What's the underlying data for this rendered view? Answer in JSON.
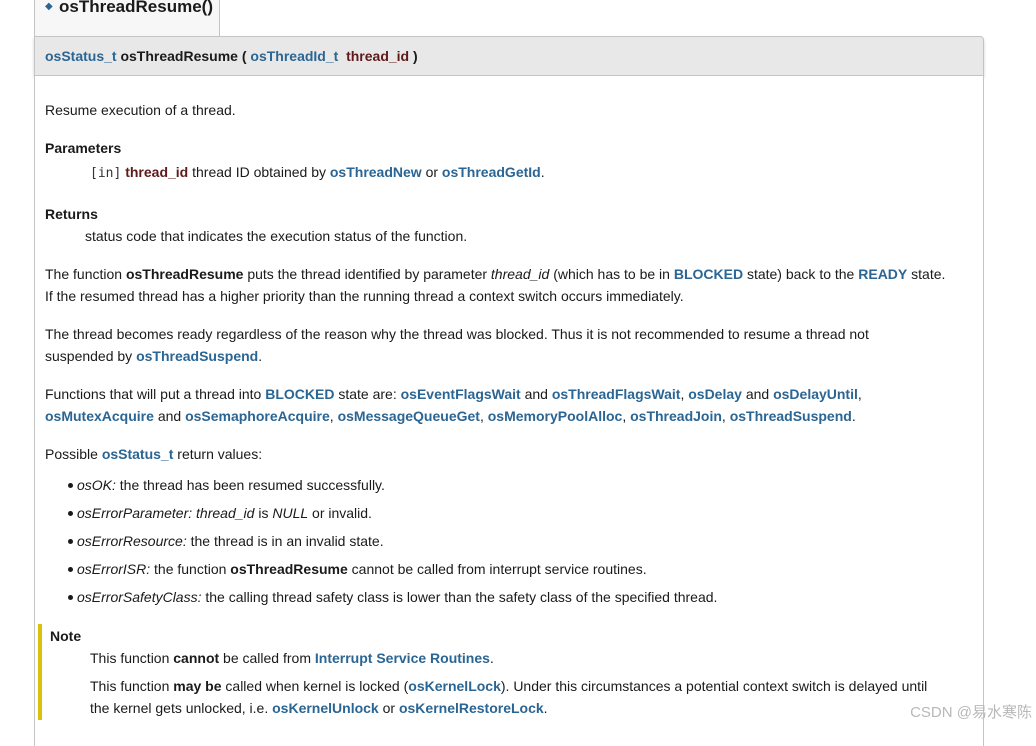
{
  "header": {
    "tab_title": "osThreadResume()",
    "sig_ret_type": "osStatus_t",
    "sig_func": "osThreadResume",
    "sig_open": "(",
    "sig_param_type": "osThreadId_t",
    "sig_param_name": "thread_id",
    "sig_close": ")"
  },
  "doc": {
    "brief": "Resume execution of a thread.",
    "params_heading": "Parameters",
    "param_dir": "[in]",
    "param_name": "thread_id",
    "param_desc_1": "thread ID obtained by",
    "param_link_1": "osThreadNew",
    "param_or": "or",
    "param_link_2": "osThreadGetId",
    "param_end": ".",
    "returns_heading": "Returns",
    "returns_desc": "status code that indicates the execution status of the function.",
    "p1_a": "The function",
    "p1_func": "osThreadResume",
    "p1_b": "puts the thread identified by parameter",
    "p1_param": "thread_id",
    "p1_c": "(which has to be in",
    "p1_blocked": "BLOCKED",
    "p1_d": "state) back to the",
    "p1_ready": "READY",
    "p1_e": "state.",
    "p1_line2": "If the resumed thread has a higher priority than the running thread a context switch occurs immediately.",
    "p2_line1": "The thread becomes ready regardless of the reason why the thread was blocked. Thus it is not recommended to resume a thread not",
    "p2_line2a": "suspended by",
    "p2_link": "osThreadSuspend",
    "p2_end": ".",
    "p3_a": "Functions that will put a thread into",
    "p3_blocked": "BLOCKED",
    "p3_b": "state are:",
    "p3_links_line1": [
      "osEventFlagsWait",
      "osThreadFlagsWait",
      "osDelay",
      "osDelayUntil"
    ],
    "p3_links_line2": [
      "osMutexAcquire",
      "osSemaphoreAcquire",
      "osMessageQueueGet",
      "osMemoryPoolAlloc",
      "osThreadJoin",
      "osThreadSuspend"
    ],
    "and": "and",
    "comma": ",",
    "period": ".",
    "p4_a": "Possible",
    "p4_link": "osStatus_t",
    "p4_b": "return values:",
    "retvals": [
      {
        "code": "osOK:",
        "desc": "the thread has been resumed successfully."
      },
      {
        "code": "osErrorParameter:",
        "desc_it": "thread_id",
        "desc_a": "is",
        "desc_null": "NULL",
        "desc_b": "or invalid."
      },
      {
        "code": "osErrorResource:",
        "desc": "the thread is in an invalid state."
      },
      {
        "code": "osErrorISR:",
        "desc_a": "the function",
        "desc_bold": "osThreadResume",
        "desc_b": "cannot be called from interrupt service routines."
      },
      {
        "code": "osErrorSafetyClass:",
        "desc": "the calling thread safety class is lower than the safety class of the specified thread."
      }
    ]
  },
  "note": {
    "heading": "Note",
    "l1_a": "This function",
    "l1_bold": "cannot",
    "l1_b": "be called from",
    "l1_link": "Interrupt Service Routines",
    "l1_end": ".",
    "l2_a": "This function",
    "l2_bold": "may be",
    "l2_b": "called when kernel is locked (",
    "l2_link": "osKernelLock",
    "l2_c": "). Under this circumstances a potential context switch is delayed until",
    "l3_a": "the kernel gets unlocked, i.e.",
    "l3_link1": "osKernelUnlock",
    "l3_or": "or",
    "l3_link2": "osKernelRestoreLock",
    "l3_end": "."
  },
  "watermark": "CSDN @易水寒陈"
}
